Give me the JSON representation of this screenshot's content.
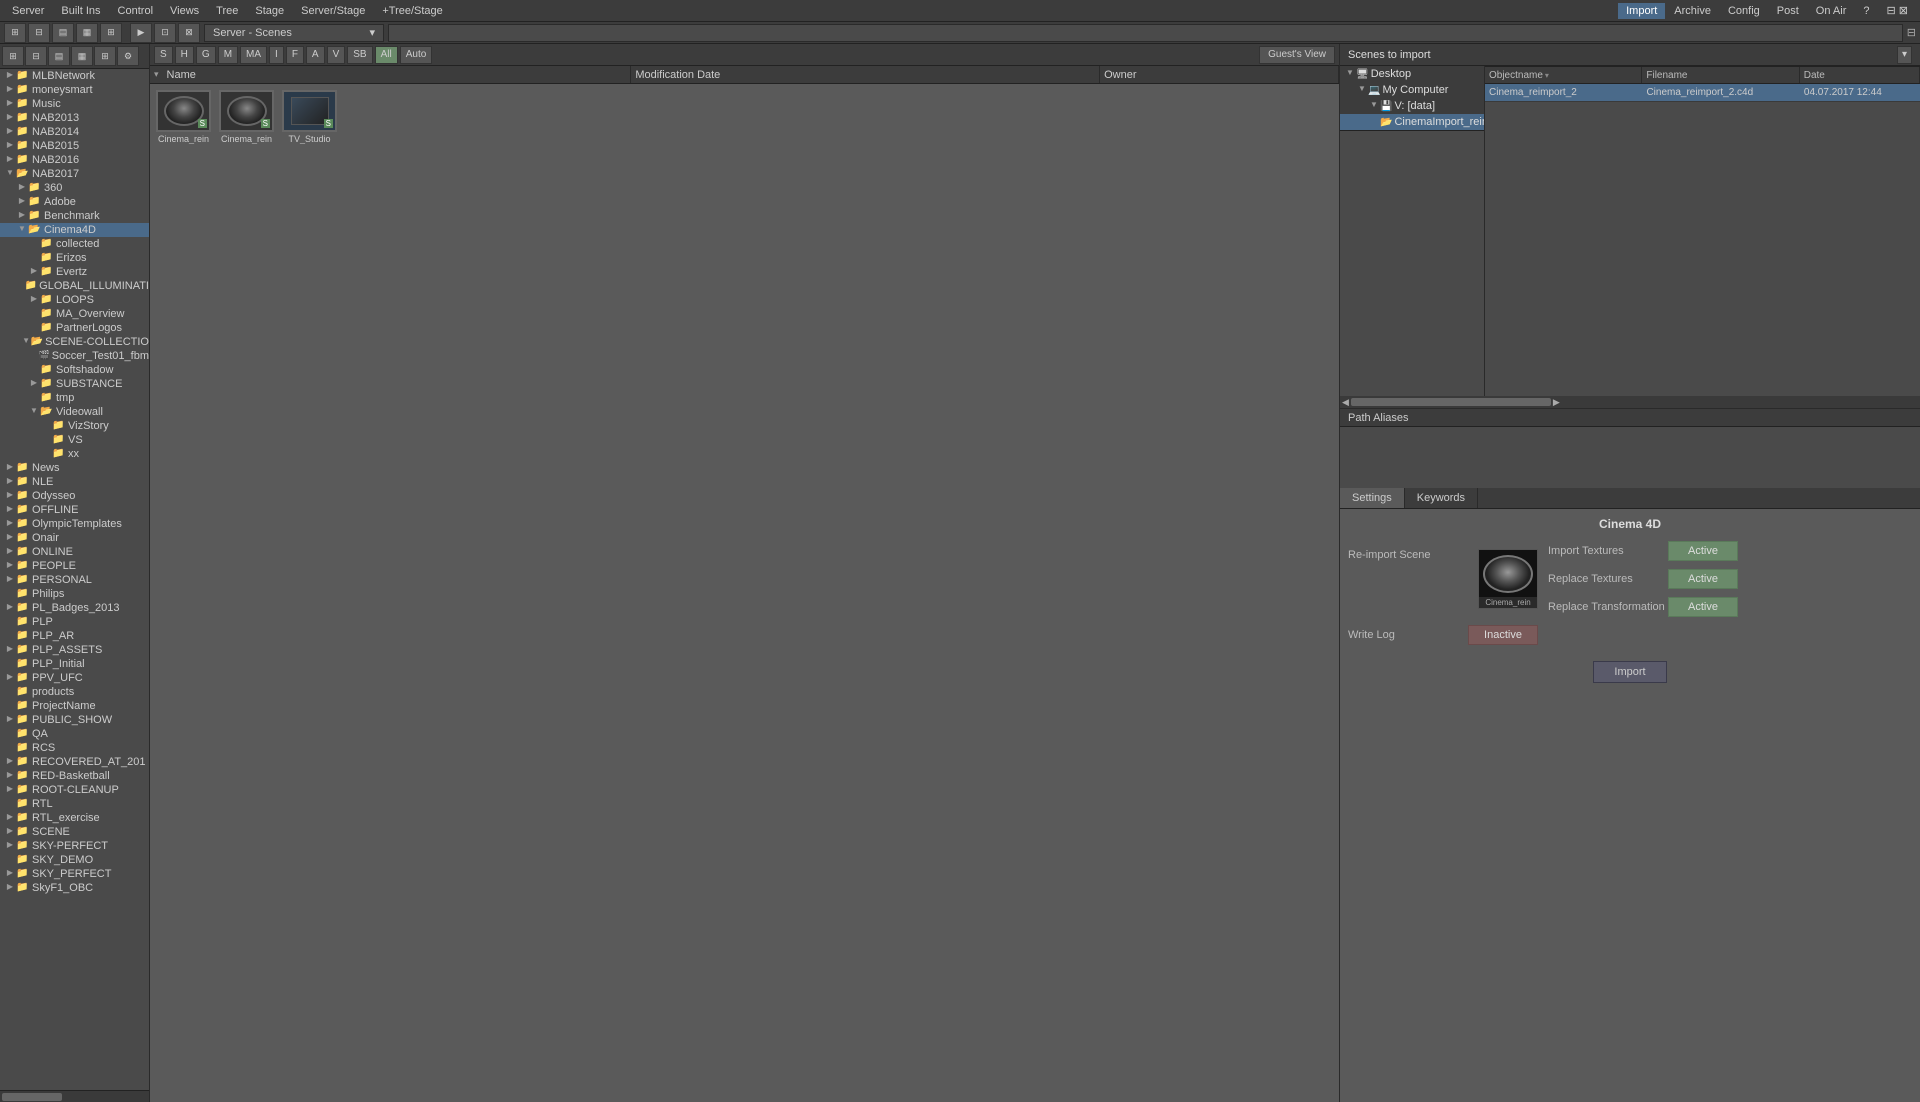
{
  "topbar": {
    "server_label": "Server",
    "builtins_label": "Built Ins",
    "control_label": "Control",
    "views_label": "Views",
    "tree_label": "Tree",
    "stage_label": "Stage",
    "server_stage_label": "Server/Stage",
    "tree_stage_label": "+Tree/Stage",
    "import_label": "Import",
    "archive_label": "Archive",
    "config_label": "Config",
    "post_label": "Post",
    "on_air_label": "On Air",
    "server_scenes_label": "Server - Scenes",
    "scenes_to_import_label": "Scenes to import"
  },
  "filters": {
    "buttons": [
      "S",
      "H",
      "G",
      "M",
      "MA",
      "I",
      "F",
      "A",
      "V",
      "SB",
      "All",
      "Auto"
    ],
    "view": "Guest's View"
  },
  "columns": {
    "name": "Name",
    "modification_date": "Modification Date",
    "owner": "Owner"
  },
  "thumbnails": [
    {
      "label": "Cinema_rein",
      "badge": "S",
      "selected": false
    },
    {
      "label": "Cinema_rein",
      "badge": "S",
      "selected": false
    },
    {
      "label": "TV_Studio",
      "badge": "S",
      "selected": false
    }
  ],
  "left_tree": {
    "items": [
      {
        "label": "MLBNetwork",
        "level": 0,
        "type": "folder",
        "expanded": false
      },
      {
        "label": "moneysmart",
        "level": 0,
        "type": "folder",
        "expanded": false
      },
      {
        "label": "Music",
        "level": 0,
        "type": "folder",
        "expanded": false
      },
      {
        "label": "NAB2013",
        "level": 0,
        "type": "folder",
        "expanded": false
      },
      {
        "label": "NAB2014",
        "level": 0,
        "type": "folder",
        "expanded": false
      },
      {
        "label": "NAB2015",
        "level": 0,
        "type": "folder",
        "expanded": false
      },
      {
        "label": "NAB2016",
        "level": 0,
        "type": "folder",
        "expanded": false
      },
      {
        "label": "NAB2017",
        "level": 0,
        "type": "folder",
        "expanded": true
      },
      {
        "label": "360",
        "level": 1,
        "type": "folder",
        "expanded": false
      },
      {
        "label": "Adobe",
        "level": 1,
        "type": "folder",
        "expanded": false
      },
      {
        "label": "Benchmark",
        "level": 1,
        "type": "folder",
        "expanded": false
      },
      {
        "label": "Cinema4D",
        "level": 1,
        "type": "folder",
        "expanded": true,
        "selected": true
      },
      {
        "label": "collected",
        "level": 2,
        "type": "folder",
        "expanded": false
      },
      {
        "label": "Erizos",
        "level": 2,
        "type": "folder",
        "expanded": false
      },
      {
        "label": "Evertz",
        "level": 2,
        "type": "folder",
        "expanded": false
      },
      {
        "label": "GLOBAL_ILLUMINATI",
        "level": 2,
        "type": "folder",
        "expanded": false
      },
      {
        "label": "LOOPS",
        "level": 2,
        "type": "folder",
        "expanded": false
      },
      {
        "label": "MA_Overview",
        "level": 2,
        "type": "folder",
        "expanded": false
      },
      {
        "label": "PartnerLogos",
        "level": 2,
        "type": "folder",
        "expanded": false
      },
      {
        "label": "SCENE-COLLECTIO",
        "level": 2,
        "type": "folder",
        "expanded": true
      },
      {
        "label": "Soccer_Test01_fbm",
        "level": 3,
        "type": "file",
        "expanded": false
      },
      {
        "label": "Softshadow",
        "level": 2,
        "type": "folder",
        "expanded": false
      },
      {
        "label": "SUBSTANCE",
        "level": 2,
        "type": "folder",
        "expanded": false
      },
      {
        "label": "tmp",
        "level": 2,
        "type": "folder",
        "expanded": false
      },
      {
        "label": "Videowall",
        "level": 2,
        "type": "folder",
        "expanded": true
      },
      {
        "label": "VizStory",
        "level": 3,
        "type": "folder",
        "expanded": false
      },
      {
        "label": "VS",
        "level": 3,
        "type": "folder",
        "expanded": false
      },
      {
        "label": "xx",
        "level": 3,
        "type": "folder",
        "expanded": false
      },
      {
        "label": "News",
        "level": 0,
        "type": "folder",
        "expanded": false
      },
      {
        "label": "NLE",
        "level": 0,
        "type": "folder",
        "expanded": false
      },
      {
        "label": "Odysseo",
        "level": 0,
        "type": "folder",
        "expanded": false
      },
      {
        "label": "OFFLINE",
        "level": 0,
        "type": "folder",
        "expanded": false
      },
      {
        "label": "OlympicTemplates",
        "level": 0,
        "type": "folder",
        "expanded": false
      },
      {
        "label": "Onair",
        "level": 0,
        "type": "folder",
        "expanded": false
      },
      {
        "label": "ONLINE",
        "level": 0,
        "type": "folder",
        "expanded": false
      },
      {
        "label": "PEOPLE",
        "level": 0,
        "type": "folder",
        "expanded": false
      },
      {
        "label": "PERSONAL",
        "level": 0,
        "type": "folder",
        "expanded": false
      },
      {
        "label": "Philips",
        "level": 0,
        "type": "folder",
        "expanded": false
      },
      {
        "label": "PL_Badges_2013",
        "level": 0,
        "type": "folder",
        "expanded": false
      },
      {
        "label": "PLP",
        "level": 0,
        "type": "folder",
        "expanded": false
      },
      {
        "label": "PLP_AR",
        "level": 0,
        "type": "folder",
        "expanded": false
      },
      {
        "label": "PLP_ASSETS",
        "level": 0,
        "type": "folder",
        "expanded": false
      },
      {
        "label": "PLP_Initial",
        "level": 0,
        "type": "folder",
        "expanded": false
      },
      {
        "label": "PPV_UFC",
        "level": 0,
        "type": "folder",
        "expanded": false
      },
      {
        "label": "products",
        "level": 0,
        "type": "folder",
        "expanded": false
      },
      {
        "label": "ProjectName",
        "level": 0,
        "type": "folder",
        "expanded": false
      },
      {
        "label": "PUBLIC_SHOW",
        "level": 0,
        "type": "folder",
        "expanded": false
      },
      {
        "label": "QA",
        "level": 0,
        "type": "folder",
        "expanded": false
      },
      {
        "label": "RCS",
        "level": 0,
        "type": "folder",
        "expanded": false
      },
      {
        "label": "RECOVERED_AT_201",
        "level": 0,
        "type": "folder",
        "expanded": false
      },
      {
        "label": "RED-Basketball",
        "level": 0,
        "type": "folder",
        "expanded": false
      },
      {
        "label": "ROOT-CLEANUP",
        "level": 0,
        "type": "folder",
        "expanded": false
      },
      {
        "label": "RTL",
        "level": 0,
        "type": "folder",
        "expanded": false
      },
      {
        "label": "RTL_exercise",
        "level": 0,
        "type": "folder",
        "expanded": false
      },
      {
        "label": "SCENE",
        "level": 0,
        "type": "folder",
        "expanded": false
      },
      {
        "label": "SKY-PERFECT",
        "level": 0,
        "type": "folder",
        "expanded": false
      },
      {
        "label": "SKY_DEMO",
        "level": 0,
        "type": "folder",
        "expanded": false
      },
      {
        "label": "SKY_PERFECT",
        "level": 0,
        "type": "folder",
        "expanded": false
      },
      {
        "label": "SkyF1_OBC",
        "level": 0,
        "type": "folder",
        "expanded": false
      }
    ]
  },
  "browser": {
    "desktop_label": "Desktop",
    "my_computer_label": "My Computer",
    "data_label": "V: [data]",
    "cinema_import_label": "CinemaImport_reimport",
    "columns": {
      "objectname": "Objectname",
      "filename": "Filename",
      "date": "Date"
    },
    "files": [
      {
        "objectname": "Cinema_reimport_2",
        "filename": "Cinema_reimport_2.c4d",
        "date": "04.07.2017 12:44"
      }
    ]
  },
  "settings": {
    "title": "Cinema 4D",
    "tab_settings": "Settings",
    "tab_keywords": "Keywords",
    "re_import_scene_label": "Re-import Scene",
    "write_log_label": "Write Log",
    "import_textures_label": "Import Textures",
    "replace_textures_label": "Replace Textures",
    "replace_transformation_label": "Replace Transformation",
    "preview_filename": "Cinema_rein",
    "status": {
      "import_textures": "Active",
      "replace_textures": "Active",
      "replace_transformation": "Active",
      "write_log": "Inactive"
    },
    "import_button": "Import",
    "path_aliases": "Path Aliases"
  }
}
